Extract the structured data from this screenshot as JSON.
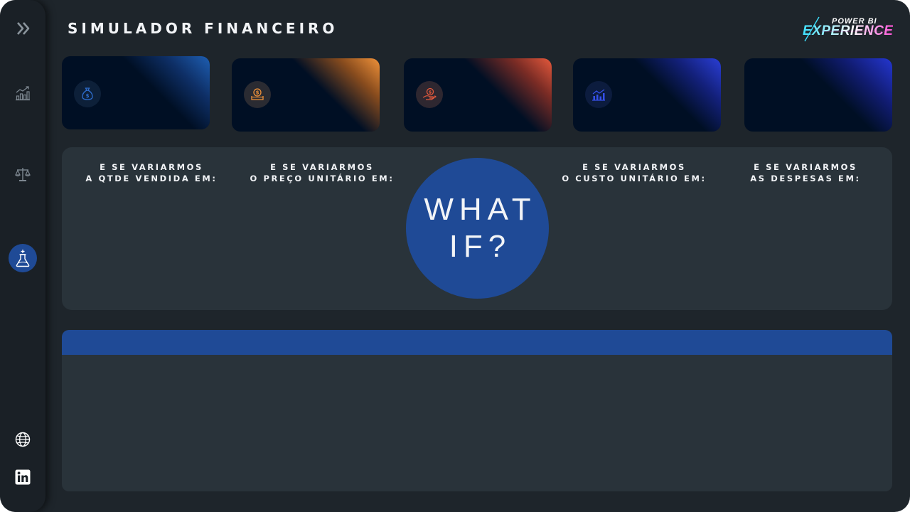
{
  "header": {
    "title": "SIMULADOR FINANCEIRO",
    "logo": {
      "line1": "POWER BI",
      "line2": "EXPERIENCE"
    }
  },
  "sidebar": {
    "items": [
      {
        "icon": "double-chevron-right-icon",
        "active": false
      },
      {
        "icon": "bar-chart-trend-icon",
        "active": false
      },
      {
        "icon": "balance-scale-icon",
        "active": false
      },
      {
        "icon": "flask-icon",
        "active": true
      },
      {
        "icon": "globe-icon",
        "active": false
      },
      {
        "icon": "linkedin-icon",
        "active": false
      }
    ]
  },
  "kpi_cards": [
    {
      "icon": "money-bag-icon",
      "accent": "#1e5fb3"
    },
    {
      "icon": "dollar-coin-hand-icon",
      "accent": "#f0923a"
    },
    {
      "icon": "hand-coin-icon",
      "accent": "#e4593c"
    },
    {
      "icon": "line-bar-chart-icon",
      "accent": "#2a3ed6"
    },
    {
      "icon": "",
      "accent": "#2436d0"
    }
  ],
  "whatif": {
    "circle": {
      "line1": "WHAT",
      "line2": "IF?"
    },
    "labels": [
      {
        "line1": "E SE VARIARMOS",
        "line2": "A QTDE VENDIDA EM:"
      },
      {
        "line1": "E SE VARIARMOS",
        "line2": "O PREÇO UNITÁRIO EM:"
      },
      {
        "line1": "E SE VARIARMOS",
        "line2": "O CUSTO UNITÁRIO EM:"
      },
      {
        "line1": "E SE VARIARMOS",
        "line2": "AS DESPESAS EM:"
      }
    ]
  },
  "colors": {
    "background": "#1e252b",
    "sidebar": "#1a2026",
    "panel": "#29333a",
    "accent_blue": "#1f4a96",
    "card": "#000f24"
  }
}
